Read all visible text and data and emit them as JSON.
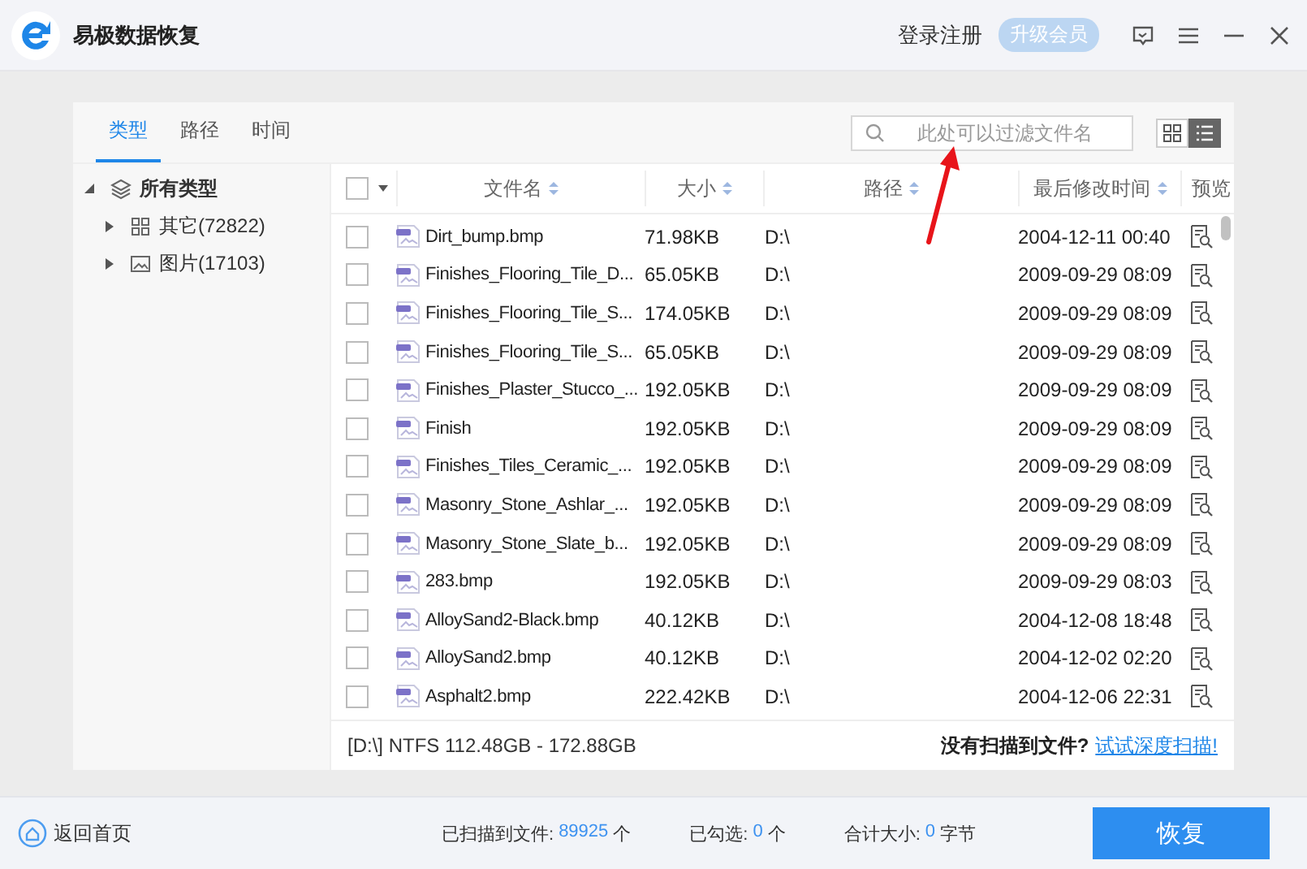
{
  "window": {
    "title": "易极数据恢复",
    "login": "登录注册",
    "upgrade": "升级会员"
  },
  "tabs": [
    {
      "label": "类型",
      "selected": true
    },
    {
      "label": "路径",
      "selected": false
    },
    {
      "label": "时间",
      "selected": false
    }
  ],
  "search": {
    "placeholder": "此处可以过滤文件名"
  },
  "view_toggle": [
    {
      "kind": "grid",
      "selected": false
    },
    {
      "kind": "list",
      "selected": true
    }
  ],
  "tree": [
    {
      "label": "所有类型",
      "kind": "layers",
      "expanded": true,
      "children": [
        {
          "label": "其它(72822)",
          "kind": "grid",
          "expanded": false
        },
        {
          "label": "图片(17103)",
          "kind": "image",
          "expanded": false
        }
      ]
    }
  ],
  "table": {
    "select_all": {
      "checked": false
    },
    "columns": [
      "文件名",
      "大小",
      "路径",
      "最后修改时间",
      "预览"
    ],
    "rows": [
      {
        "checked": false,
        "name": "Dirt_bump.bmp",
        "size": "71.98KB",
        "path": "D:\\",
        "modified": "2004-12-11 00:40"
      },
      {
        "checked": false,
        "name": "Finishes_Flooring_Tile_D...",
        "size": "65.05KB",
        "path": "D:\\",
        "modified": "2009-09-29 08:09"
      },
      {
        "checked": false,
        "name": "Finishes_Flooring_Tile_S...",
        "size": "174.05KB",
        "path": "D:\\",
        "modified": "2009-09-29 08:09"
      },
      {
        "checked": false,
        "name": "Finishes_Flooring_Tile_S...",
        "size": "65.05KB",
        "path": "D:\\",
        "modified": "2009-09-29 08:09"
      },
      {
        "checked": false,
        "name": "Finishes_Plaster_Stucco_...",
        "size": "192.05KB",
        "path": "D:\\",
        "modified": "2009-09-29 08:09"
      },
      {
        "checked": false,
        "name": "Finish",
        "size": "192.05KB",
        "path": "D:\\",
        "modified": "2009-09-29 08:09"
      },
      {
        "checked": false,
        "name": "Finishes_Tiles_Ceramic_...",
        "size": "192.05KB",
        "path": "D:\\",
        "modified": "2009-09-29 08:09"
      },
      {
        "checked": false,
        "name": "Masonry_Stone_Ashlar_...",
        "size": "192.05KB",
        "path": "D:\\",
        "modified": "2009-09-29 08:09"
      },
      {
        "checked": false,
        "name": "Masonry_Stone_Slate_b...",
        "size": "192.05KB",
        "path": "D:\\",
        "modified": "2009-09-29 08:09"
      },
      {
        "checked": false,
        "name": "283.bmp",
        "size": "192.05KB",
        "path": "D:\\",
        "modified": "2009-09-29 08:03"
      },
      {
        "checked": false,
        "name": "AlloySand2-Black.bmp",
        "size": "40.12KB",
        "path": "D:\\",
        "modified": "2004-12-08 18:48"
      },
      {
        "checked": false,
        "name": "AlloySand2.bmp",
        "size": "40.12KB",
        "path": "D:\\",
        "modified": "2004-12-02 02:20"
      },
      {
        "checked": false,
        "name": "Asphalt2.bmp",
        "size": "222.42KB",
        "path": "D:\\",
        "modified": "2004-12-06 22:31"
      }
    ]
  },
  "drive_info": "[D:\\] NTFS 112.48GB - 172.88GB",
  "no_files_hint": "没有扫描到文件?",
  "deep_scan_link": "试试深度扫描!",
  "footer": {
    "home": "返回首页",
    "stats": [
      {
        "label": "已扫描到文件:",
        "value": "89925",
        "unit": "个"
      },
      {
        "label": "已勾选:",
        "value": "0",
        "unit": "个"
      },
      {
        "label": "合计大小:",
        "value": "0",
        "unit": "字节"
      }
    ],
    "restore": "恢复"
  }
}
